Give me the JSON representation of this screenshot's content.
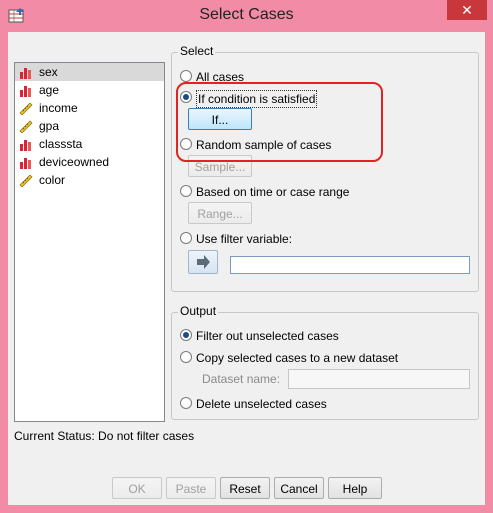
{
  "window": {
    "title": "Select Cases",
    "close_glyph": "✕"
  },
  "variables": [
    {
      "name": "sex",
      "icon": "nominal-bar-icon",
      "selected": true
    },
    {
      "name": "age",
      "icon": "nominal-bar-icon"
    },
    {
      "name": "income",
      "icon": "scale-ruler-icon"
    },
    {
      "name": "gpa",
      "icon": "scale-ruler-icon"
    },
    {
      "name": "classsta",
      "icon": "nominal-bar-icon"
    },
    {
      "name": "deviceowned",
      "icon": "nominal-bar-icon"
    },
    {
      "name": "color",
      "icon": "scale-ruler-icon"
    }
  ],
  "select": {
    "legend": "Select",
    "all_cases": "All cases",
    "if_condition": "If condition is satisfied",
    "if_button": "If...",
    "random_sample": "Random sample of cases",
    "sample_button": "Sample...",
    "based_on_time": "Based on time or case range",
    "range_button": "Range...",
    "use_filter": "Use filter variable:",
    "filter_value": ""
  },
  "output": {
    "legend": "Output",
    "filter_out": "Filter out unselected cases",
    "copy_selected": "Copy selected cases to a new dataset",
    "dataset_name_label": "Dataset name:",
    "dataset_name_value": "",
    "delete_unselected": "Delete unselected cases"
  },
  "status": "Current Status: Do not filter cases",
  "buttons": {
    "ok": "OK",
    "paste": "Paste",
    "reset": "Reset",
    "cancel": "Cancel",
    "help": "Help"
  },
  "colors": {
    "titlebar": "#f28ca6",
    "close": "#c7373b",
    "highlight": "#e02424"
  }
}
